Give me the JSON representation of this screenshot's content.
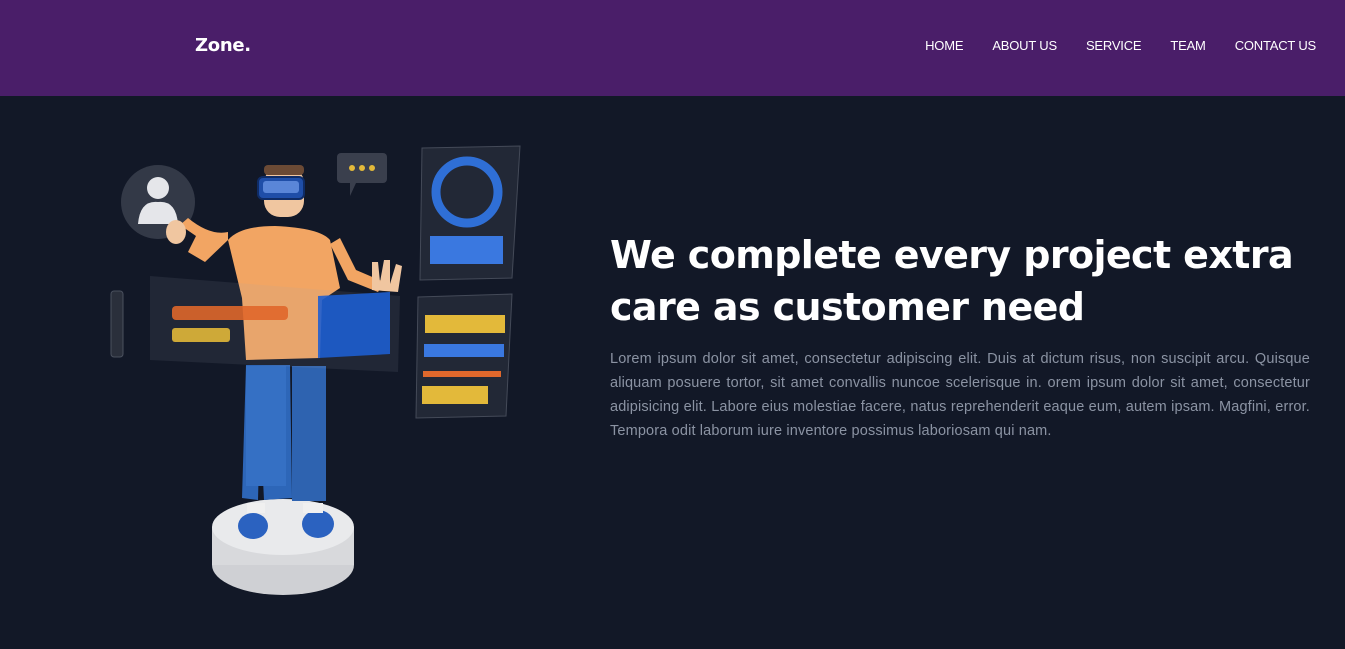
{
  "header": {
    "logo": "Zone.",
    "nav": [
      {
        "label": "HOME"
      },
      {
        "label": "ABOUT US"
      },
      {
        "label": "SERVICE"
      },
      {
        "label": "TEAM"
      },
      {
        "label": "CONTACT US"
      }
    ]
  },
  "hero": {
    "title": "We complete every project extra care as customer need",
    "paragraph": "Lorem ipsum dolor sit amet, consectetur adipiscing elit. Duis at dictum risus, non suscipit arcu. Quisque aliquam posuere tortor, sit amet convallis nuncoe scelerisque in. orem ipsum dolor sit amet, consectetur adipisicing elit. Labore eius molestiae facere, natus reprehenderit eaque eum, autem ipsam. Magfini, error. Tempora odit laborum iure inventore possimus laboriosam qui nam.",
    "illustration": "vr-person-3d-illustration"
  },
  "colors": {
    "header_bg": "#4a1e69",
    "page_bg": "#121827",
    "accent_blue": "#2f6fd6",
    "accent_orange": "#e0682c",
    "accent_yellow": "#e3b93a"
  }
}
